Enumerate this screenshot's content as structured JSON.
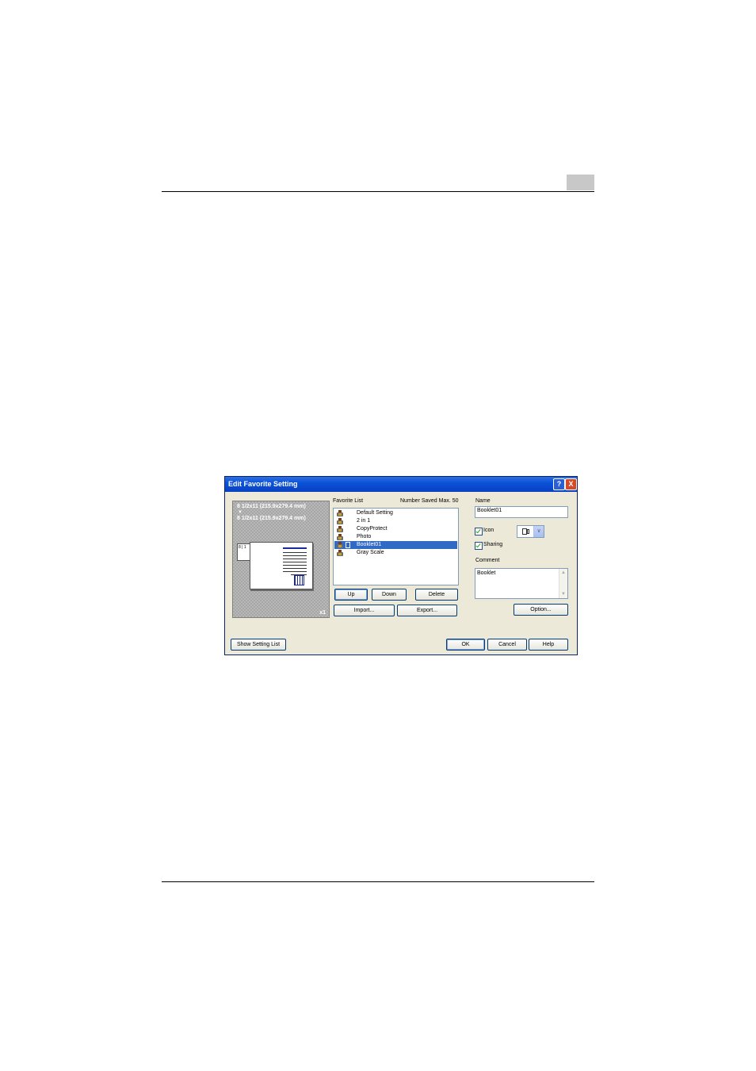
{
  "dialog": {
    "title": "Edit Favorite Setting",
    "help_glyph": "?",
    "close_glyph": "X"
  },
  "preview": {
    "source_paper": "8 1/2x11 (215.9x279.4 mm)",
    "arrow": "▼",
    "output_paper": "8 1/2x11 (215.9x279.4 mm)",
    "copies": "x1",
    "mini_label": "8 | 1"
  },
  "favorite_list": {
    "label": "Favorite List",
    "number_saved": "Number Saved Max. 50",
    "items": [
      {
        "label": "Default Setting",
        "icon": "printer-icon"
      },
      {
        "label": "2 in 1",
        "icon": "printer-icon"
      },
      {
        "label": "CopyProtect",
        "icon": "printer-icon"
      },
      {
        "label": "Photo",
        "icon": "printer-icon"
      },
      {
        "label": "Booklet01",
        "icon": "booklet-icon",
        "selected": true
      },
      {
        "label": "Gray Scale",
        "icon": "printer-icon"
      }
    ],
    "up_label": "Up",
    "down_label": "Down",
    "delete_label": "Delete",
    "import_label": "Import...",
    "export_label": "Export..."
  },
  "settings": {
    "name_label": "Name",
    "name_value": "Booklet01",
    "icon_label": "Icon",
    "icon_checked": true,
    "icon_selected": "booklet-icon",
    "sharing_label": "Sharing",
    "sharing_checked": true,
    "comment_label": "Comment",
    "comment_value": "Booklet",
    "option_label": "Option..."
  },
  "footer": {
    "show_setting_list_label": "Show Setting List",
    "ok_label": "OK",
    "cancel_label": "Cancel",
    "help_label": "Help"
  }
}
